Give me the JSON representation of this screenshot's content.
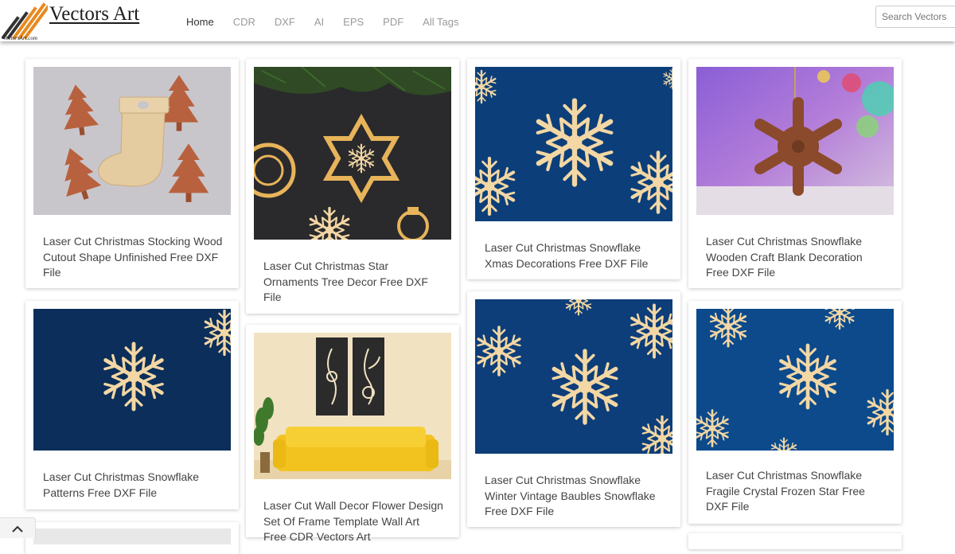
{
  "header": {
    "brand": "Vectors Art",
    "brand_small": "VectorsArt.com",
    "nav": [
      "Home",
      "CDR",
      "DXF",
      "AI",
      "EPS",
      "PDF",
      "All Tags"
    ],
    "active_nav": "Home",
    "search_placeholder": "Search Vectors"
  },
  "colors": {
    "accent_orange": "#e8891e",
    "snowflake_wood": "#f3d7a4",
    "blue_bg": "#0c3f7a"
  },
  "cards": [
    {
      "title": "Laser Cut Christmas Stocking Wood Cutout Shape Unfinished Free DXF File"
    },
    {
      "title": "Laser Cut Christmas Star Ornaments Tree Decor Free DXF File"
    },
    {
      "title": "Laser Cut Christmas Snowflake Xmas Decorations Free DXF File"
    },
    {
      "title": "Laser Cut Christmas Snowflake Wooden Craft Blank Decoration Free DXF File"
    },
    {
      "title": "Laser Cut Christmas Snowflake Patterns Free DXF File"
    },
    {
      "title": "Laser Cut Wall Decor Flower Design Set Of Frame Template Wall Art Free CDR Vectors Art"
    },
    {
      "title": "Laser Cut Christmas Snowflake Winter Vintage Baubles Snowflake Free DXF File"
    },
    {
      "title": "Laser Cut Christmas Snowflake Fragile Crystal Frozen Star Free DXF File"
    }
  ]
}
